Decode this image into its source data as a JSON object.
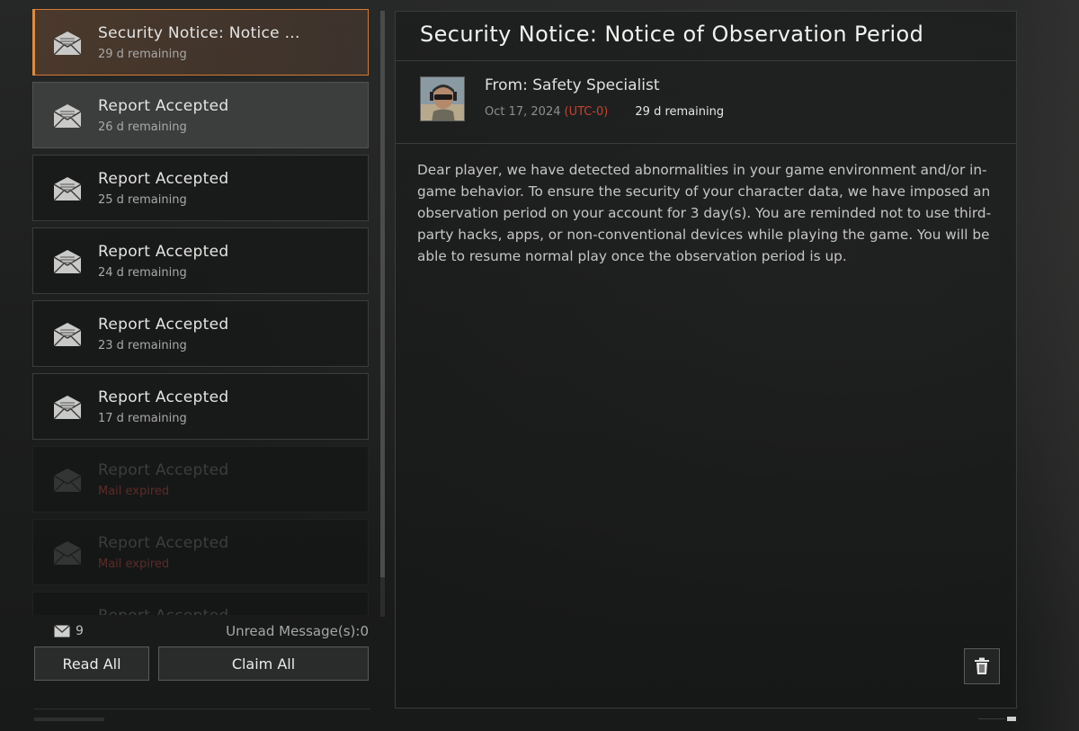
{
  "mail_list": {
    "items": [
      {
        "title": "Security Notice: Notice ...",
        "subtitle": "29 d remaining",
        "state": "selected"
      },
      {
        "title": "Report Accepted",
        "subtitle": "26 d remaining",
        "state": "hover"
      },
      {
        "title": "Report Accepted",
        "subtitle": "25 d remaining",
        "state": "normal"
      },
      {
        "title": "Report Accepted",
        "subtitle": "24 d remaining",
        "state": "normal"
      },
      {
        "title": "Report Accepted",
        "subtitle": "23 d remaining",
        "state": "normal"
      },
      {
        "title": "Report Accepted",
        "subtitle": "17 d remaining",
        "state": "normal"
      },
      {
        "title": "Report Accepted",
        "subtitle": "Mail expired",
        "state": "expired"
      },
      {
        "title": "Report Accepted",
        "subtitle": "Mail expired",
        "state": "expired"
      },
      {
        "title": "Report Accepted",
        "subtitle": "",
        "state": "expired"
      }
    ],
    "icon": "envelope-icon"
  },
  "footer": {
    "mail_count": "9",
    "unread_label": "Unread Message(s):0",
    "read_all_label": "Read All",
    "claim_all_label": "Claim All"
  },
  "detail": {
    "title": "Security Notice: Notice of Observation Period",
    "from": "From: Safety Specialist",
    "date": "Oct 17, 2024",
    "timezone": "(UTC-0)",
    "remaining": "29 d remaining",
    "body": "Dear player, we have detected abnormalities in your game environment and/or in-game behavior. To ensure the security of your character data, we have imposed an observation period on your account for 3 day(s). You are reminded not to use third-party hacks, apps, or non-conventional devices while playing the game. You will be able to resume normal play once the observation period is up.",
    "delete_icon": "trash-icon"
  },
  "colors": {
    "accent_orange": "#d37b35",
    "timezone_red": "#c4432f",
    "expired_red": "#5b2c27"
  }
}
